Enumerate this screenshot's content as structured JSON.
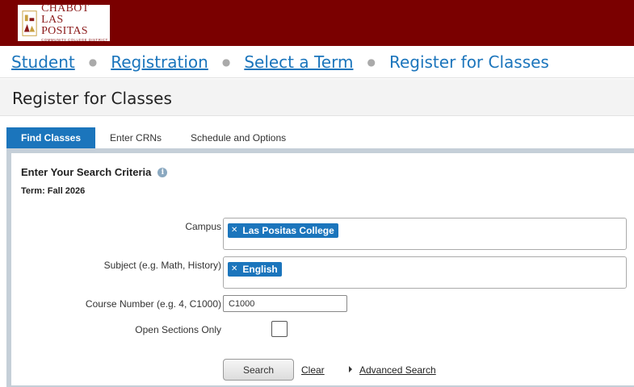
{
  "logo": {
    "line1": "CHABOT",
    "line2": "LAS POSITAS",
    "line3": "COMMUNITY COLLEGE DISTRICT",
    "icon": "college-logo-icon"
  },
  "breadcrumb": {
    "items": [
      "Student",
      "Registration",
      "Select a Term"
    ],
    "current": "Register for Classes"
  },
  "page": {
    "title": "Register for Classes"
  },
  "tabs": [
    {
      "label": "Find Classes",
      "active": true
    },
    {
      "label": "Enter CRNs",
      "active": false
    },
    {
      "label": "Schedule and Options",
      "active": false
    }
  ],
  "search": {
    "heading": "Enter Your Search Criteria",
    "term": "Term: Fall 2026",
    "campus_label": "Campus",
    "campus_chip": "Las Positas College",
    "subject_label": "Subject (e.g. Math, History)",
    "subject_chip": "English",
    "course_label": "Course Number (e.g. 4, C1000)",
    "course_value": "C1000",
    "open_label": "Open Sections Only",
    "search_button": "Search",
    "clear_link": "Clear",
    "advanced_link": "Advanced Search"
  },
  "colors": {
    "brand": "#7a0000",
    "accent": "#1b75bc"
  }
}
